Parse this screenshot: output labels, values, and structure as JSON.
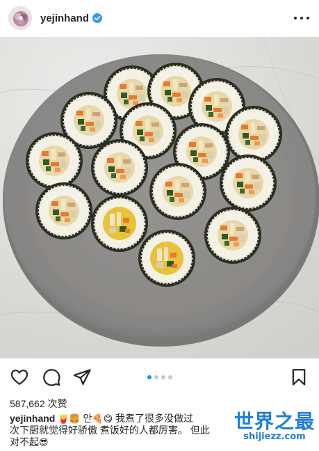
{
  "header": {
    "username": "yejinhand",
    "icons": {
      "avatar": "avatar",
      "verified": "verified-badge-icon",
      "more": "more-options-icon"
    }
  },
  "post": {
    "image_subject": "photo",
    "carousel": {
      "count": 4,
      "active_index": 0
    }
  },
  "actions": {
    "icons": [
      "heart-icon",
      "comment-icon",
      "share-icon",
      "bookmark-icon"
    ]
  },
  "likes": {
    "text": "587,662 次赞"
  },
  "caption": {
    "username": "yejinhand",
    "emojis_1": "🍟🍔",
    "word_an": "안",
    "emojis_2": "🍕😋",
    "line1": "我煮了很多没做过",
    "line2": "次下厨就觉得好骄傲 煮饭好的人都厉害。 但此",
    "line3": "对不起",
    "emoji_end": "😎"
  },
  "watermark": {
    "title": "世界之最",
    "url": "shijiezz.com"
  },
  "colors": {
    "accent": "#0095f6",
    "text": "#262626",
    "watermark": "#1f7fd6"
  }
}
